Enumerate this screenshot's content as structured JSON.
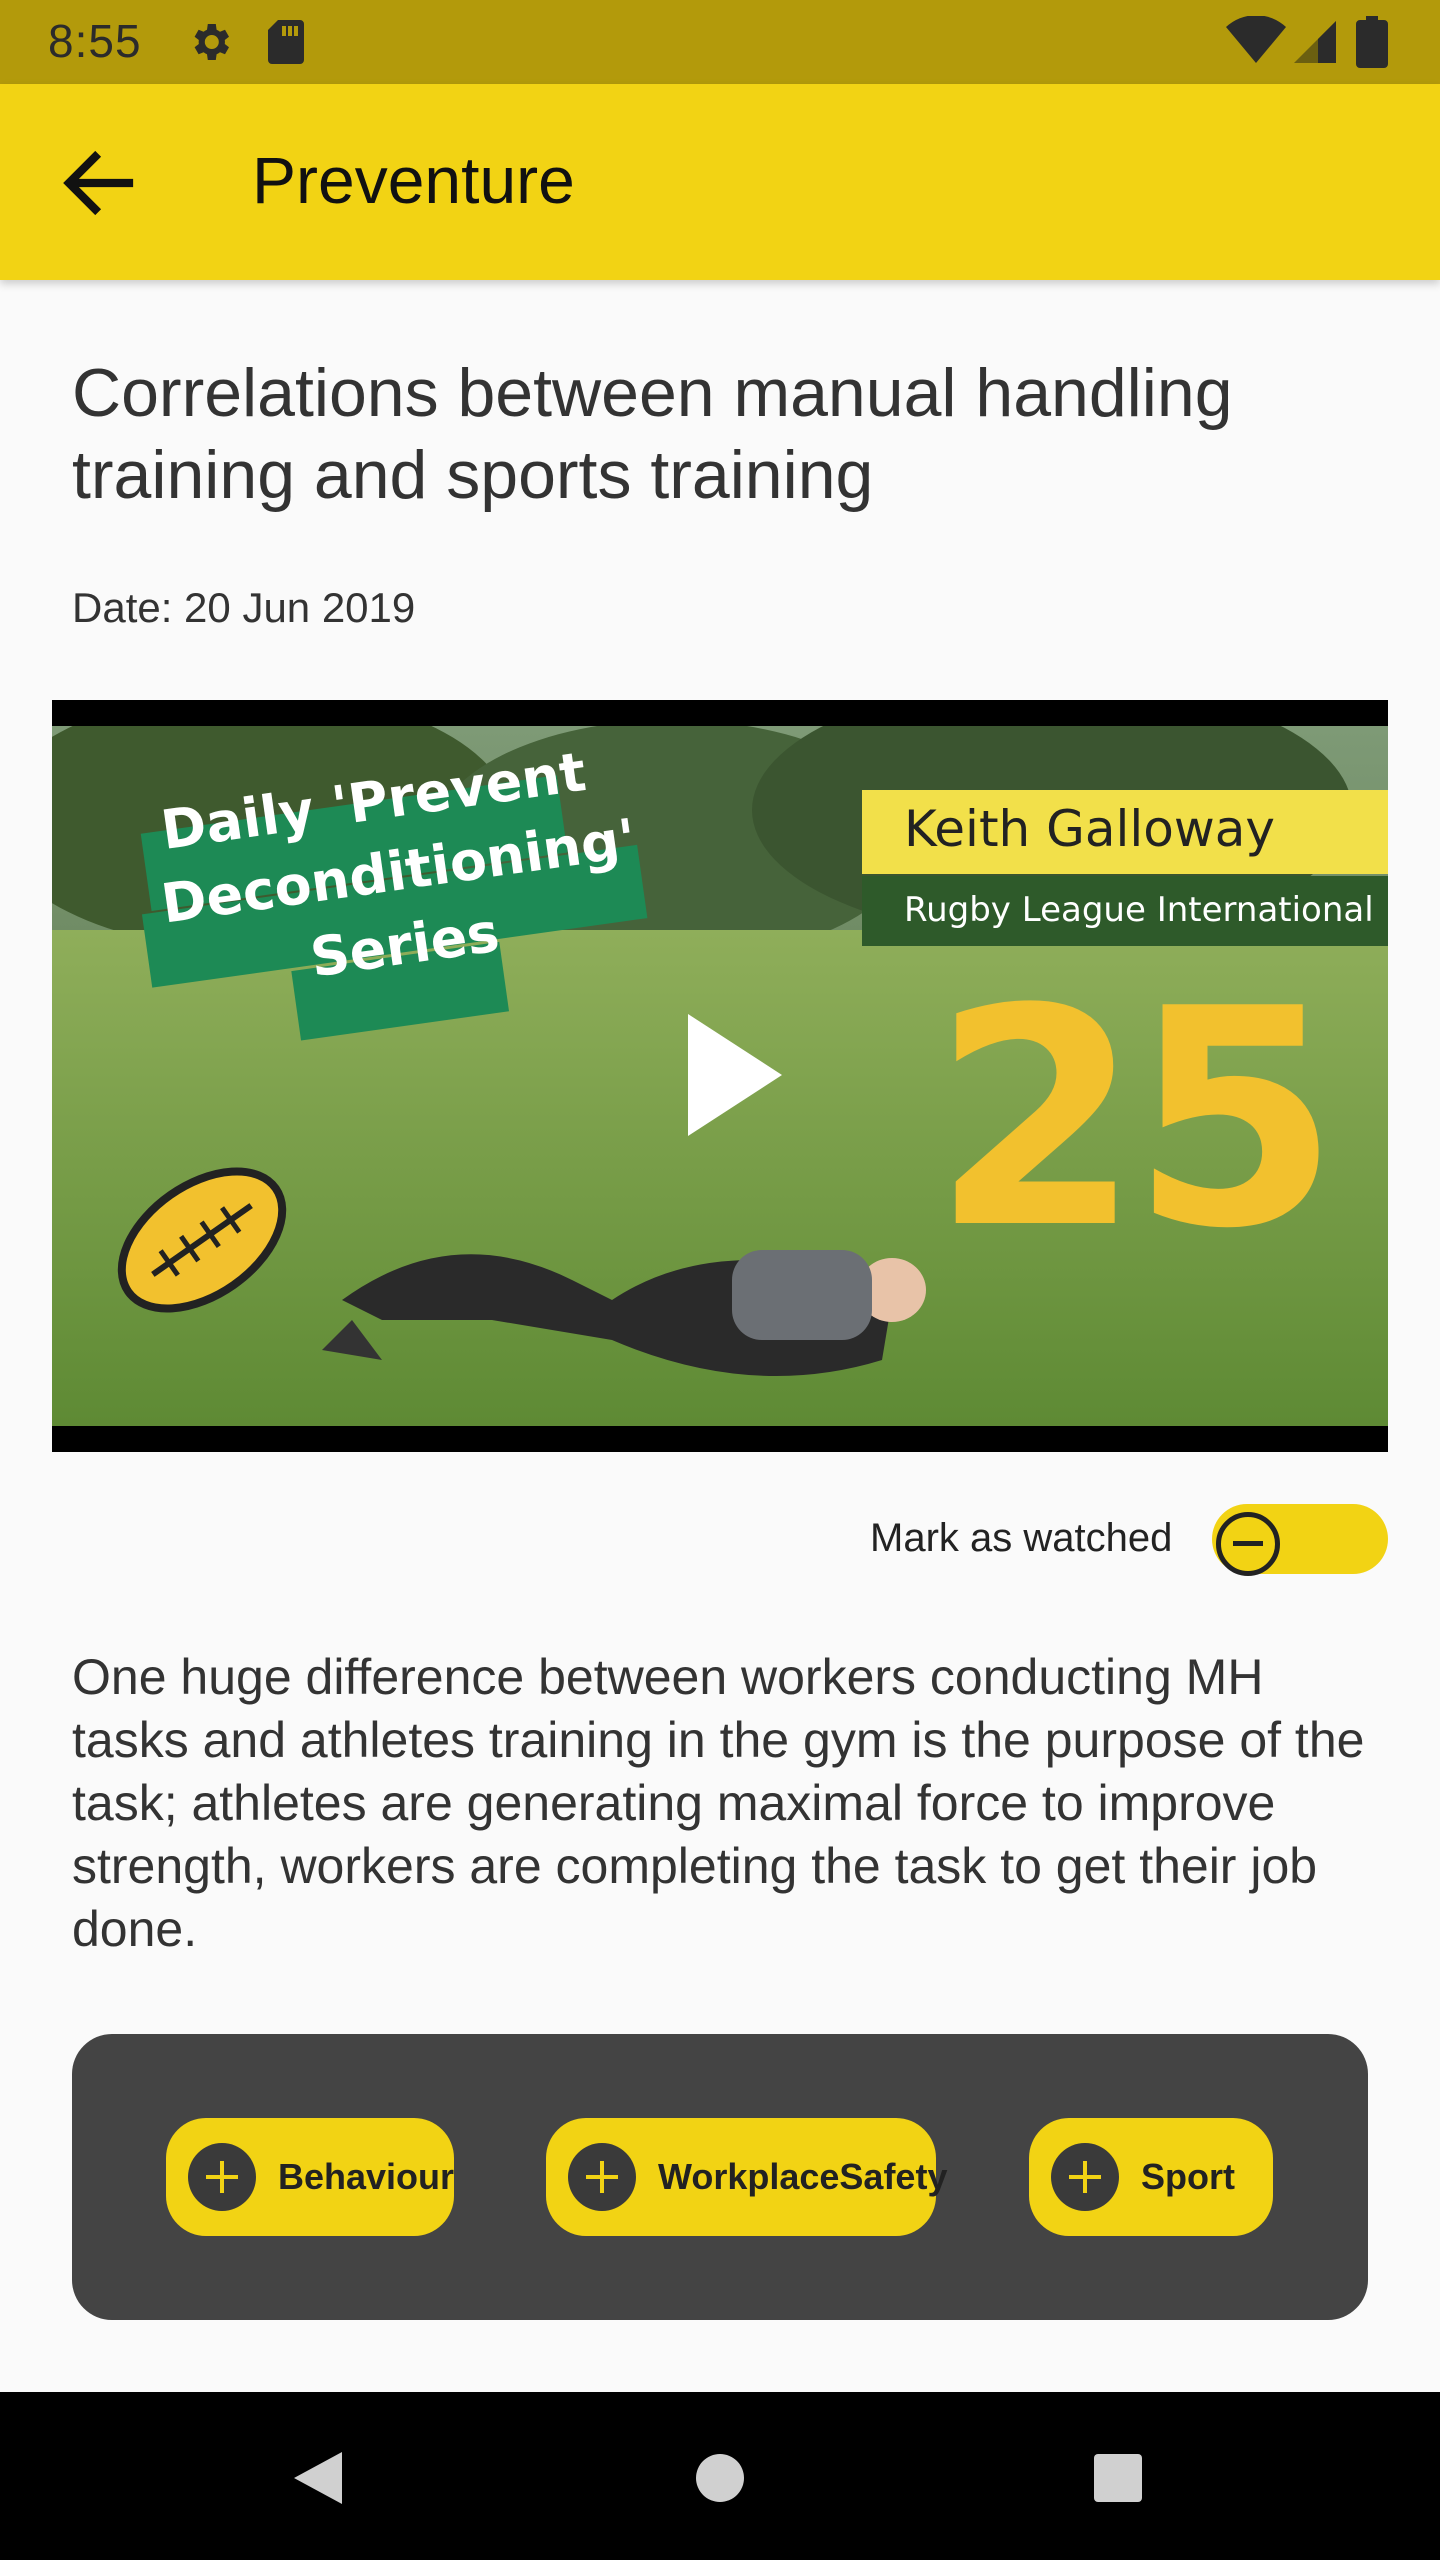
{
  "status_bar": {
    "time": "8:55",
    "icons": [
      "settings-gear-icon",
      "sd-card-icon",
      "wifi-icon",
      "cell-signal-icon",
      "battery-icon"
    ],
    "background": "#b39a0b"
  },
  "app_bar": {
    "title": "Preventure",
    "back_icon": "arrow-back-icon",
    "background": "#f2d314"
  },
  "article": {
    "title": "Correlations between manual handling training and sports training",
    "date": "Date: 20 Jun 2019",
    "description": "One huge difference between workers conducting MH tasks and athletes training in the gym is the purpose of the task; athletes are generating maximal force to improve strength, workers are completing the task to get their job done."
  },
  "video": {
    "banner_lines": [
      "Daily 'Prevent",
      "Deconditioning'",
      "Series"
    ],
    "presenter_name": "Keith Galloway",
    "presenter_role": "Rugby League International",
    "episode_number": "25",
    "play_icon": "play-icon"
  },
  "watched": {
    "label": "Mark as watched",
    "toggle_on": false
  },
  "tags": [
    {
      "label": "Behaviour",
      "icon": "plus-circle-icon"
    },
    {
      "label": "WorkplaceSafety",
      "icon": "plus-circle-icon"
    },
    {
      "label": "Sport",
      "icon": "plus-circle-icon"
    }
  ],
  "nav_bar": {
    "buttons": [
      "back-triangle-icon",
      "home-circle-icon",
      "recents-square-icon"
    ]
  }
}
